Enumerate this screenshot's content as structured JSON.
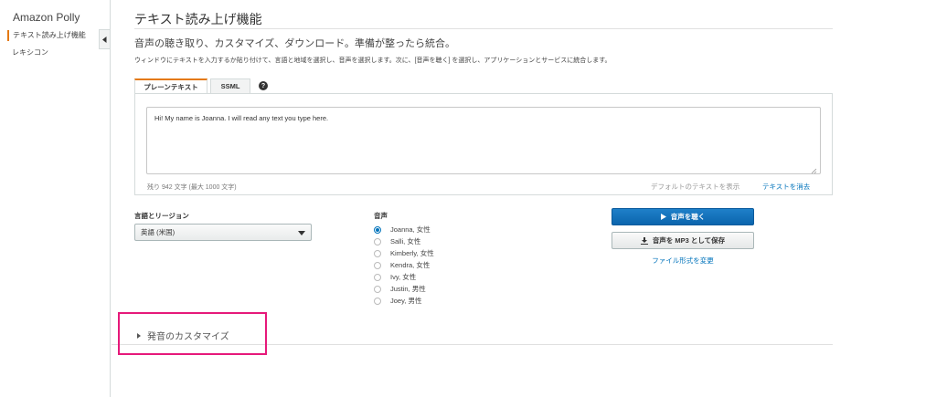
{
  "sidebar": {
    "title": "Amazon Polly",
    "items": [
      {
        "label": "テキスト読み上げ機能",
        "active": true
      },
      {
        "label": "レキシコン",
        "active": false
      }
    ],
    "collapse_icon": "chevron-left-icon"
  },
  "main": {
    "title": "テキスト読み上げ機能",
    "subtitle": "音声の聴き取り、カスタマイズ、ダウンロード。準備が整ったら統合。",
    "instructions": "ウィンドウにテキストを入力するか貼り付けて、言語と地域を選択し、音声を選択します。次に、[音声を聴く] を選択し、アプリケーションとサービスに統合します。",
    "tabs": [
      {
        "label": "プレーンテキスト",
        "active": true
      },
      {
        "label": "SSML",
        "active": false
      }
    ],
    "help_icon": "?",
    "textarea_value": "Hi! My name is Joanna. I will read any text you type here.",
    "char_count": "残り 942 文字 (最大 1000 文字)",
    "default_text_link": "デフォルトのテキストを表示",
    "clear_text_link": "テキストを消去"
  },
  "language": {
    "label": "言語とリージョン",
    "selected": "英語 (米国)"
  },
  "voices": {
    "label": "音声",
    "options": [
      {
        "label": "Joanna, 女性",
        "checked": true
      },
      {
        "label": "Salli, 女性",
        "checked": false
      },
      {
        "label": "Kimberly, 女性",
        "checked": false
      },
      {
        "label": "Kendra, 女性",
        "checked": false
      },
      {
        "label": "Ivy, 女性",
        "checked": false
      },
      {
        "label": "Justin, 男性",
        "checked": false
      },
      {
        "label": "Joey, 男性",
        "checked": false
      }
    ]
  },
  "actions": {
    "listen_label": "音声を聴く",
    "save_label": "音声を MP3 として保存",
    "format_link": "ファイル形式を変更"
  },
  "pronunciation": {
    "label": "発音のカスタマイズ"
  },
  "colors": {
    "accent": "#e47911",
    "primary_button": "#0b65ad",
    "link": "#0073bb",
    "highlight": "#e6197a"
  }
}
